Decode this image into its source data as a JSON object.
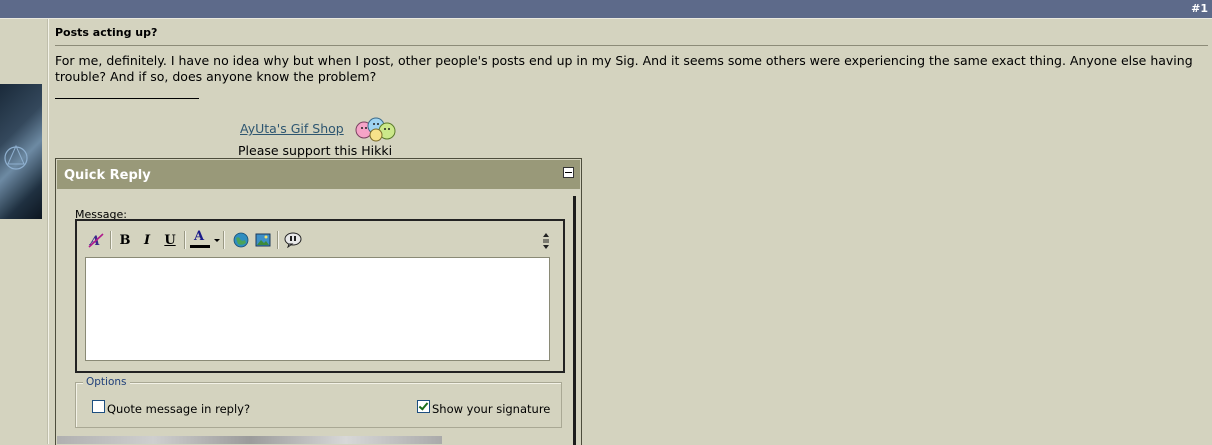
{
  "post": {
    "number": "#1",
    "title": "Posts acting up?",
    "body": "For me, definitely. I have no idea why but when I post, other people's posts end up in my Sig. And it seems some others were experiencing the same exact thing. Anyone else having trouble? And if so, does anyone know the problem?"
  },
  "signature": {
    "link_text": "AyUta's Gif Shop",
    "text": "Please support this Hikki"
  },
  "quick_reply": {
    "title": "Quick Reply",
    "message_label": "Message:",
    "toolbar": {
      "bold": "B",
      "italic": "I",
      "underline": "U",
      "font_color_letter": "A",
      "font_color_bar": "#000000"
    },
    "message_value": "",
    "options": {
      "legend": "Options",
      "quote_label": "Quote message in reply?",
      "quote_checked": false,
      "signature_label": "Show your signature",
      "signature_checked": true
    }
  },
  "colors": {
    "page_bg": "#d4d3bf",
    "topbar": "#5d6a8a",
    "quick_reply_header": "#999979",
    "link": "#2e5670"
  }
}
